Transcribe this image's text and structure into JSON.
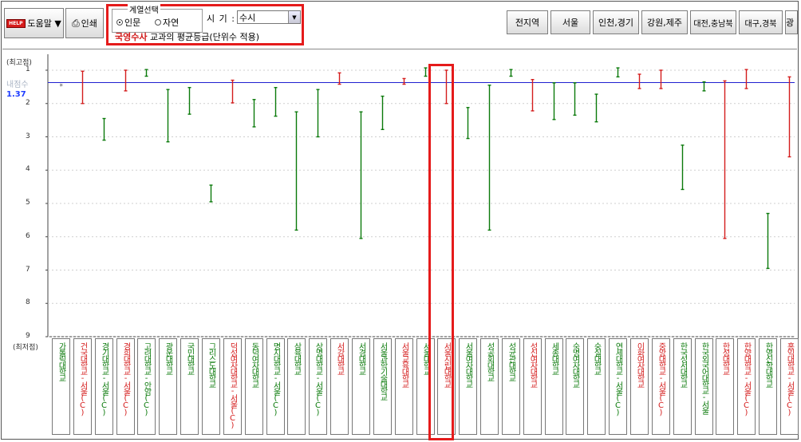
{
  "toolbar": {
    "help_label": "도움말 ▼",
    "help_logo": "HELP",
    "print_label": "인쇄"
  },
  "selection": {
    "group_title": "계열선택",
    "radio_humanities": "인문",
    "radio_natural": "자연",
    "period_label": "시 기 :",
    "period_value": "수시",
    "subject_highlight": "국영수사",
    "subject_text": "교과의 평균등급(단위수 적용)"
  },
  "regions": [
    "전지역",
    "서울",
    "인천,경기",
    "강원,제주",
    "대전,충남북",
    "대구,경북",
    "광"
  ],
  "axis": {
    "top_label": "(최고점)",
    "bottom_label": "(최저점)",
    "ticks": [
      "1",
      "2",
      "3",
      "4",
      "5",
      "6",
      "7",
      "8",
      "9"
    ]
  },
  "average": {
    "label": "내점수",
    "value": "1.37",
    "grade": 1.37
  },
  "colors": {
    "green": "#0b7a0b",
    "red": "#d41c1c",
    "avg_line": "#2020d0",
    "highlight": "#e51b1b"
  },
  "chart_data": {
    "type": "range",
    "y_axis": "grade",
    "ylim": [
      1,
      9
    ],
    "inverted": true,
    "reference_line": 1.37,
    "universities": [
      {
        "name": "가톨릭대학교",
        "color": "green",
        "high": null,
        "low": null
      },
      {
        "name": "건국대학교-서울(C)",
        "color": "red",
        "high": 1.03,
        "low": 2.0
      },
      {
        "name": "경기대학교-서울(C)",
        "color": "green",
        "high": 2.45,
        "low": 3.1
      },
      {
        "name": "경희대학교-서울(C)",
        "color": "red",
        "high": 1.0,
        "low": 1.62
      },
      {
        "name": "고려대학교-안암(C)",
        "color": "green",
        "high": 0.98,
        "low": 1.18
      },
      {
        "name": "광운대학교",
        "color": "green",
        "high": 1.58,
        "low": 3.15
      },
      {
        "name": "국민대학교",
        "color": "green",
        "high": 1.52,
        "low": 2.32
      },
      {
        "name": "그리스도대학교",
        "color": "green",
        "high": 4.45,
        "low": 4.95
      },
      {
        "name": "덕성여자대학교-서울(C)",
        "color": "red",
        "high": 1.3,
        "low": 1.98
      },
      {
        "name": "동덕여자대학교",
        "color": "green",
        "high": 1.88,
        "low": 2.7
      },
      {
        "name": "명지대학교-서울(C)",
        "color": "green",
        "high": 1.52,
        "low": 2.38
      },
      {
        "name": "삼육대학교",
        "color": "green",
        "high": 2.25,
        "low": 5.8
      },
      {
        "name": "상명대학교-서울(C)",
        "color": "green",
        "high": 1.58,
        "low": 3.0
      },
      {
        "name": "서강대학교",
        "color": "red",
        "high": 1.08,
        "low": 1.42
      },
      {
        "name": "서경대학교",
        "color": "green",
        "high": 2.25,
        "low": 6.05
      },
      {
        "name": "서울과학기술대학교",
        "color": "green",
        "high": 1.78,
        "low": 2.78
      },
      {
        "name": "서울교육대학교",
        "color": "red",
        "high": 1.25,
        "low": 1.42
      },
      {
        "name": "서울대학교",
        "color": "green",
        "high": 0.93,
        "low": 1.18
      },
      {
        "name": "서울시립대학교",
        "color": "red",
        "high": 1.0,
        "low": 2.0
      },
      {
        "name": "서울여자대학교",
        "color": "green",
        "high": 2.12,
        "low": 3.05
      },
      {
        "name": "성공회대학교",
        "color": "green",
        "high": 1.45,
        "low": 5.8
      },
      {
        "name": "성균관대학교",
        "color": "green",
        "high": 0.98,
        "low": 1.18
      },
      {
        "name": "성신여자대학교",
        "color": "red",
        "high": 1.28,
        "low": 2.22
      },
      {
        "name": "세종대학교",
        "color": "green",
        "high": 1.38,
        "low": 2.48
      },
      {
        "name": "숙명여자대학교",
        "color": "green",
        "high": 1.38,
        "low": 2.35
      },
      {
        "name": "숭실대학교",
        "color": "green",
        "high": 1.72,
        "low": 2.55
      },
      {
        "name": "연세대학교-서울(C)",
        "color": "green",
        "high": 0.93,
        "low": 1.2
      },
      {
        "name": "이화여자대학교",
        "color": "red",
        "high": 1.12,
        "low": 1.55
      },
      {
        "name": "중앙대학교-서울(C)",
        "color": "red",
        "high": 1.0,
        "low": 1.55
      },
      {
        "name": "한국성서대학교",
        "color": "green",
        "high": 3.25,
        "low": 4.58
      },
      {
        "name": "한국외국어대학교-서울",
        "color": "green",
        "high": 1.35,
        "low": 1.62
      },
      {
        "name": "한성대학교",
        "color": "red",
        "high": 1.32,
        "low": 6.05
      },
      {
        "name": "한양대학교-서울(C)",
        "color": "red",
        "high": 0.98,
        "low": 1.55
      },
      {
        "name": "한영신학대학교",
        "color": "green",
        "high": 5.3,
        "low": 6.95
      },
      {
        "name": "홍익대학교-서울(C)",
        "color": "red",
        "high": 1.2,
        "low": 3.6
      }
    ]
  }
}
